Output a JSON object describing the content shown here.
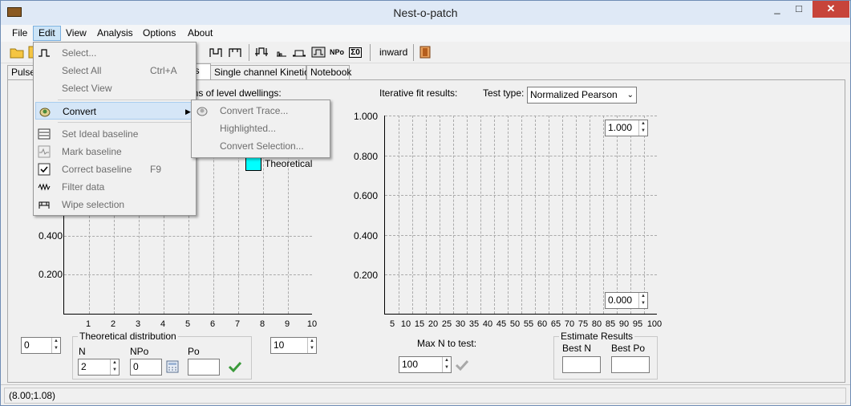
{
  "window": {
    "title": "Nest-o-patch",
    "min": "_",
    "max": "□",
    "close": "✕"
  },
  "menubar": [
    "File",
    "Edit",
    "View",
    "Analysis",
    "Options",
    "About"
  ],
  "toolbar": {
    "direction_label": "inward",
    "npo_label": "NPo",
    "sigma_label": "Σ0"
  },
  "tabs": [
    "Pulse",
    "is",
    "Single channel Kinetics",
    "Notebook"
  ],
  "left_panel": {
    "header": "ons of level dwellings:",
    "legend_theoretical": "Theoretical",
    "legend_color": "#00ffff",
    "y_ticks": [
      "0.400",
      "0.200"
    ],
    "x_ticks": [
      "1",
      "2",
      "3",
      "4",
      "5",
      "6",
      "7",
      "8",
      "9",
      "10"
    ],
    "left_spin": "0",
    "right_spin": "10",
    "theoretical_group": "Theoretical distribution",
    "n_label": "N",
    "n_value": "2",
    "npo_label": "NPo",
    "npo_value": "0",
    "po_label": "Po"
  },
  "right_panel": {
    "header": "Iterative fit results:",
    "test_type_label": "Test type:",
    "test_type_value": "Normalized Pearson",
    "y_ticks": [
      "1.000",
      "0.800",
      "0.600",
      "0.400",
      "0.200"
    ],
    "x_ticks": [
      "5",
      "10",
      "15",
      "20",
      "25",
      "30",
      "35",
      "40",
      "45",
      "50",
      "55",
      "60",
      "65",
      "70",
      "75",
      "80",
      "85",
      "90",
      "95",
      "100"
    ],
    "ymax_spin": "1.000",
    "ymin_spin": "0.000",
    "max_n_label": "Max N to test:",
    "max_n_value": "100",
    "estimate_group": "Estimate Results",
    "best_n_label": "Best N",
    "best_po_label": "Best Po"
  },
  "edit_menu": {
    "items": [
      {
        "label": "Select...",
        "shortcut": ""
      },
      {
        "label": "Select All",
        "shortcut": "Ctrl+A"
      },
      {
        "label": "Select View",
        "shortcut": ""
      },
      {
        "label": "Convert",
        "shortcut": ""
      },
      {
        "label": "Set Ideal baseline",
        "shortcut": ""
      },
      {
        "label": "Mark baseline",
        "shortcut": ""
      },
      {
        "label": "Correct baseline",
        "shortcut": "F9"
      },
      {
        "label": "Filter data",
        "shortcut": ""
      },
      {
        "label": "Wipe selection",
        "shortcut": ""
      }
    ]
  },
  "convert_submenu": [
    "Convert Trace...",
    "Highlighted...",
    "Convert Selection..."
  ],
  "status": "(8.00;1.08)"
}
